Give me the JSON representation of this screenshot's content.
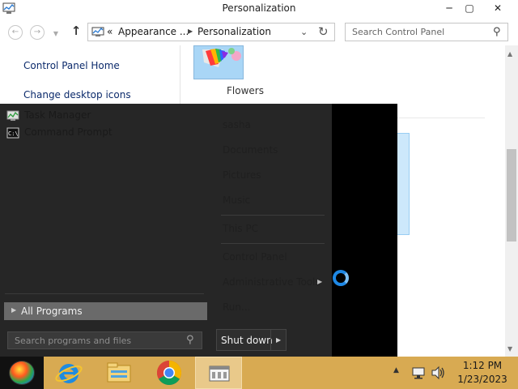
{
  "window": {
    "title": "Personalization",
    "controls": {
      "minimize": "─",
      "maximize": "▢",
      "close": "✕"
    },
    "address": {
      "overflow": "«",
      "crumb_1": "Appearance ...",
      "crumb_2": "Personalization",
      "separator": "▶"
    },
    "search": {
      "placeholder": "Search Control Panel"
    },
    "left_pane": {
      "links": [
        "Control Panel Home",
        "Change desktop icons"
      ]
    },
    "content": {
      "theme_label": "Flowers"
    }
  },
  "start_menu": {
    "pinned": [
      {
        "label": "Task Manager",
        "icon": "task-manager-icon"
      },
      {
        "label": "Command Prompt",
        "icon": "command-prompt-icon"
      }
    ],
    "all_programs": "All Programs",
    "search_placeholder": "Search programs and files",
    "right_items": {
      "user": "sasha",
      "documents": "Documents",
      "pictures": "Pictures",
      "music": "Music",
      "this_pc": "This PC",
      "control_panel": "Control Panel",
      "admin_tools": "Administrative Tools",
      "run": "Run..."
    },
    "shutdown_label": "Shut down"
  },
  "taskbar": {
    "apps": [
      "start-orb-icon",
      "internet-explorer-icon",
      "file-explorer-icon",
      "chrome-icon",
      "control-panel-icon"
    ],
    "clock_time": "1:12 PM",
    "clock_date": "1/23/2023"
  },
  "colors": {
    "start_menu_bg": "#262626",
    "taskbar_bg": "#d8aa52",
    "all_programs_bg": "#6a6a6a",
    "busy_cursor": "#1e88e5"
  }
}
